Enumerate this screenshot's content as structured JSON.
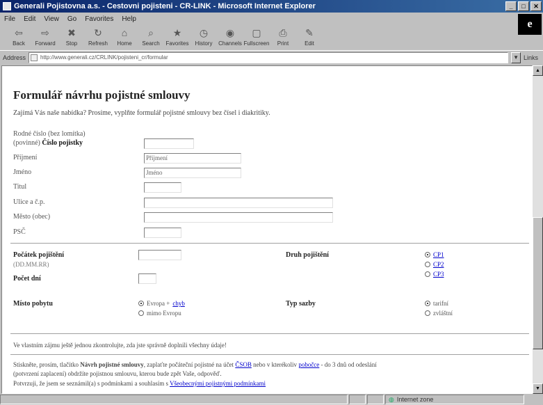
{
  "window": {
    "title": "Generali Pojistovna a.s. - Cestovni pojisteni - CR-LINK - Microsoft Internet Explorer"
  },
  "menu": [
    "File",
    "Edit",
    "View",
    "Go",
    "Favorites",
    "Help"
  ],
  "toolbar": [
    {
      "label": "Back",
      "icon": "back-arrow-icon",
      "glyph": "⇦"
    },
    {
      "label": "Forward",
      "icon": "forward-arrow-icon",
      "glyph": "⇨"
    },
    {
      "label": "Stop",
      "icon": "stop-icon",
      "glyph": "✖"
    },
    {
      "label": "Refresh",
      "icon": "refresh-icon",
      "glyph": "↻"
    },
    {
      "label": "Home",
      "icon": "home-icon",
      "glyph": "⌂"
    },
    {
      "label": "Search",
      "icon": "search-icon",
      "glyph": "⌕"
    },
    {
      "label": "Favorites",
      "icon": "favorites-icon",
      "glyph": "★"
    },
    {
      "label": "History",
      "icon": "history-icon",
      "glyph": "◷"
    },
    {
      "label": "Channels",
      "icon": "channels-icon",
      "glyph": "◉"
    },
    {
      "label": "Fullscreen",
      "icon": "fullscreen-icon",
      "glyph": "▢"
    },
    {
      "label": "Print",
      "icon": "print-icon",
      "glyph": "⎙"
    },
    {
      "label": "Edit",
      "icon": "edit-icon",
      "glyph": "✎"
    }
  ],
  "address": {
    "label": "Address",
    "url": "http://www.generali.cz/CRLINK/pojisteni_cr/formular",
    "go": "Links"
  },
  "page": {
    "title": "Formulář návrhu pojistné smlouvy",
    "intro": "Zajímá Vás naše nabídka? Prosíme, vyplňte formulář pojistné smlouvy bez čísel i diakritiky.",
    "id_label_1": "Rodné číslo (bez lomítka)",
    "id_label_2_prefix": "(povinné)",
    "id_label_2_bold": "Číslo pojistky",
    "fields": [
      {
        "label": "Příjmení",
        "value": "Příjmení"
      },
      {
        "label": "Jméno",
        "value": "Jméno"
      },
      {
        "label": "Titul",
        "value": ""
      },
      {
        "label": "Ulice a č.p.",
        "value": ""
      },
      {
        "label": "Město (obec)",
        "value": ""
      },
      {
        "label": "PSČ",
        "value": ""
      }
    ],
    "start_label": "Počátek pojištění",
    "start_sub": "(DD.MM.RR)",
    "days_label": "Počet dní",
    "type_label": "Druh pojištění",
    "type_options": [
      "CP1",
      "CP2",
      "CP3"
    ],
    "type_selected": 0,
    "place_label": "Místo pobytu",
    "place_options": [
      "Evropa + ",
      "mimo Evropu"
    ],
    "place_link": "chyb",
    "place_selected": 0,
    "rate_label": "Typ sazby",
    "rate_options": [
      "tarifní",
      "zvláštní"
    ],
    "rate_selected": 0,
    "note_1": "Ve vlastním zájmu ještě jednou zkontrolujte, zda jste správně doplnili všechny údaje!",
    "note_2_prefix": "Stiskněte, prosím, tlačítko ",
    "note_2_bold": "Návrh pojistné smlouvy",
    "note_2_mid": ", zaplaťte počáteční pojistné na účet ",
    "note_2_link1": "ČSOB",
    "note_2_suffix": " nebo v kterékoliv ",
    "note_2_link2": "pobočce",
    "note_2_end": " - do 3 dnů od odeslání",
    "note_3": "(potvrzení zaplacení) obdržíte pojistnou smlouvu, kterou bude zpět Vaše, odpověď.",
    "note_4_prefix": "Potvrzuji, že jsem se seznámil(a) s podmínkami a souhlasím s ",
    "note_4_link": "Všeobecnými pojistnými podmínkami"
  },
  "status": {
    "zone": "Internet zone"
  }
}
